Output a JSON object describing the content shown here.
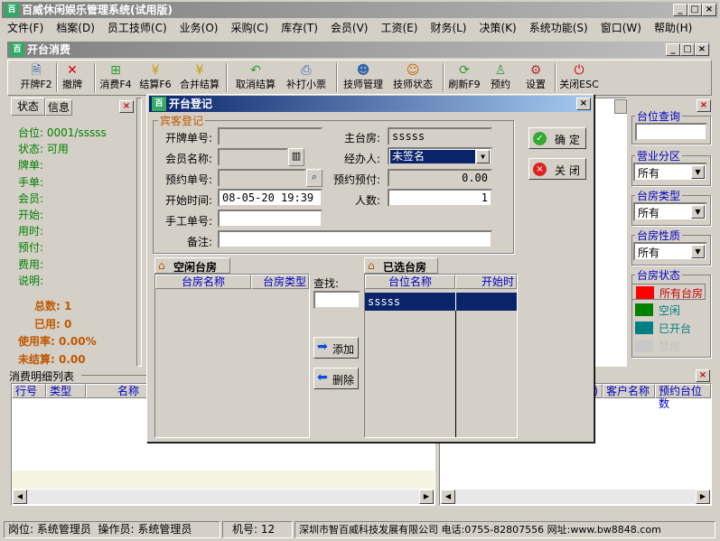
{
  "app": {
    "title": "百威休闲娱乐管理系统(试用版)"
  },
  "menu": [
    "文件(F)",
    "档案(D)",
    "员工技师(C)",
    "业务(O)",
    "采购(C)",
    "库存(T)",
    "会员(V)",
    "工资(E)",
    "财务(L)",
    "决策(K)",
    "系统功能(S)",
    "窗口(W)",
    "帮助(H)"
  ],
  "child": {
    "title": "开台消费"
  },
  "toolbar": [
    {
      "label": "开牌F2",
      "icon": "document-icon"
    },
    {
      "label": "撤牌",
      "icon": "red-x-icon"
    },
    {
      "label": "消费F4",
      "icon": "add-document-icon"
    },
    {
      "label": "结算F6",
      "icon": "money-icon"
    },
    {
      "label": "合并结算",
      "icon": "money-icon"
    },
    {
      "label": "取消结算",
      "icon": "undo-icon"
    },
    {
      "label": "补打小票",
      "icon": "printer-icon"
    },
    {
      "label": "技师管理",
      "icon": "people-icon"
    },
    {
      "label": "技师状态",
      "icon": "people-status-icon"
    },
    {
      "label": "刷新F9",
      "icon": "refresh-icon"
    },
    {
      "label": "预约",
      "icon": "person-icon"
    },
    {
      "label": "设置",
      "icon": "settings-icon"
    },
    {
      "label": "关闭ESC",
      "icon": "power-icon"
    }
  ],
  "left": {
    "tabs": [
      "状态",
      "信息"
    ],
    "info": [
      "台位: 0001/sssss",
      "状态: 可用",
      "牌单:",
      "手单:",
      "会员:",
      "开始:",
      "用时:",
      "预付:",
      "费用:",
      "说明:"
    ],
    "stats": [
      "总数: 1",
      "已用: 0",
      "使用率: 0.00%",
      "未结算: 0.00"
    ]
  },
  "detail": {
    "title": "消费明细列表",
    "columns": [
      "行号",
      "类型",
      "名称"
    ]
  },
  "right_table": {
    "columns": [
      "客户名称",
      "预约台位数"
    ]
  },
  "right_panel": {
    "seat_query": "台位查询",
    "zone_label": "营业分区",
    "zone_value": "所有",
    "type_label": "台房类型",
    "type_value": "所有",
    "nature_label": "台房性质",
    "nature_value": "所有",
    "status_label": "台房状态",
    "status_items": [
      {
        "label": "所有台房",
        "color": "#ff0000"
      },
      {
        "label": "空闲",
        "color": "#008000"
      },
      {
        "label": "已开台",
        "color": "#008080"
      },
      {
        "label": "禁用",
        "color": "#c8c8c8"
      }
    ]
  },
  "dialog": {
    "title": "开台登记",
    "group": "宾客登记",
    "labels": {
      "open_no": "开牌单号:",
      "main_room": "主台房:",
      "member": "会员名称:",
      "handler": "经办人:",
      "reserve_no": "预约单号:",
      "reserve_pay": "预约预付:",
      "start": "开始时间:",
      "people": "人数:",
      "manual": "手工单号:",
      "note": "备注:"
    },
    "values": {
      "open_no": "",
      "main_room": "sssss",
      "member": "",
      "handler": "未签名",
      "reserve_no": "",
      "reserve_pay": "0.00",
      "start": "08-05-20 19:39",
      "people": "1",
      "manual": "",
      "note": ""
    },
    "ok": "确 定",
    "close": "关 闭",
    "free_tab": "空闲台房",
    "free_cols": [
      "台房名称",
      "台房类型"
    ],
    "search_label": "查找:",
    "add": "添加",
    "delete": "删除",
    "selected_tab": "已选台房",
    "selected_cols": [
      "台位名称",
      "开始时"
    ],
    "selected_rows": [
      "sssss"
    ]
  },
  "status": {
    "post": "岗位: 系统管理员",
    "operator": "操作员: 系统管理员",
    "machine": "机号: 12",
    "company": "深圳市智百威科技发展有限公司 电话:0755-82807556 网址:www.bw8848.com"
  }
}
